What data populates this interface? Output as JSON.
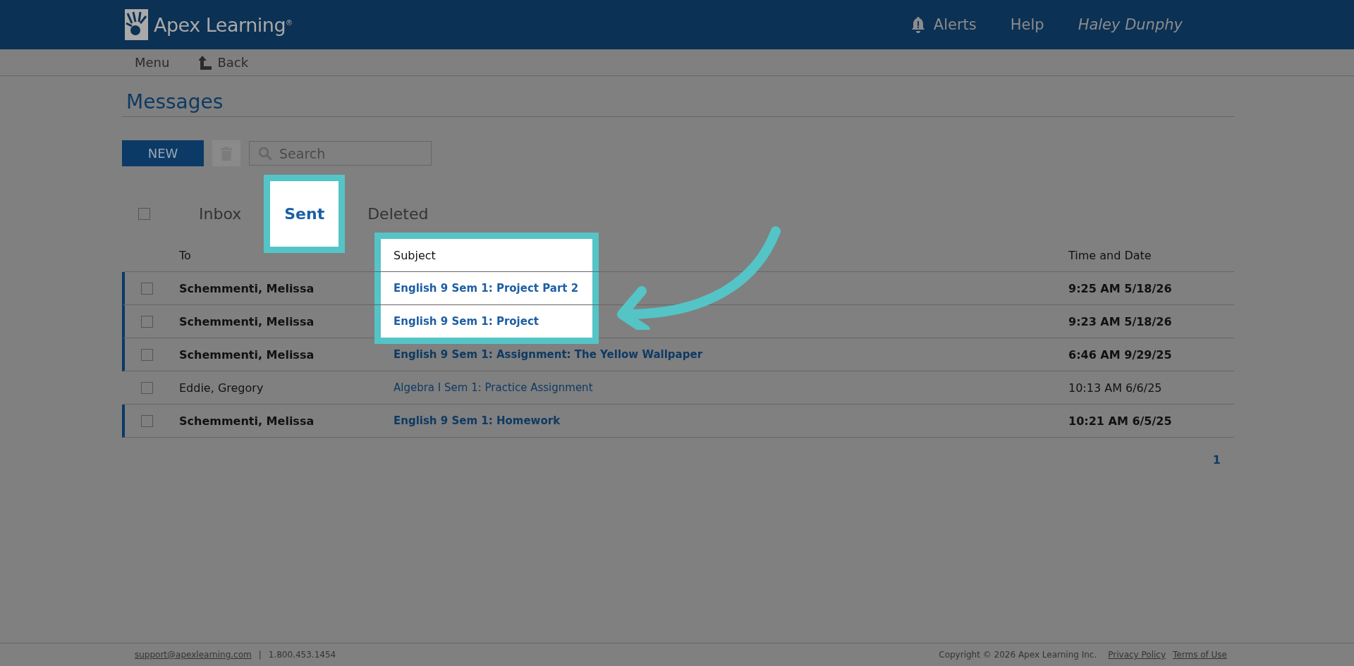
{
  "header": {
    "logo": "Apex Learning",
    "logo_mark": "®",
    "nav": [
      "Alerts",
      "Help"
    ],
    "user": "Haley Dunphy"
  },
  "subnav": {
    "menu": "Menu",
    "back": "Back"
  },
  "page_title": "Messages",
  "toolbar": {
    "new_button": "NEW",
    "search": {
      "placeholder": "Search"
    }
  },
  "select_all": {
    "checked": false
  },
  "tabs": [
    {
      "label": "Inbox",
      "selected": false,
      "highlighted": false
    },
    {
      "label": "Sent",
      "selected": true,
      "highlighted": true
    },
    {
      "label": "Deleted",
      "selected": false,
      "highlighted": false
    }
  ],
  "table": {
    "columns": [
      "To",
      "Subject",
      "Time and Date"
    ],
    "subject_highlighted": true,
    "rows": [
      {
        "to": "Schemmenti, Melissa",
        "subject": "English 9 Sem 1: Project Part 2",
        "time": "9:25 AM 5/18/26",
        "unread": true,
        "checked": false,
        "highlighted": true
      },
      {
        "to": "Schemmenti, Melissa",
        "subject": "English 9 Sem 1: Project",
        "time": "9:23 AM 5/18/26",
        "unread": true,
        "checked": false,
        "highlighted": true
      },
      {
        "to": "Schemmenti, Melissa",
        "subject": "English 9 Sem 1: Assignment: The Yellow Wallpaper",
        "time": "6:46 AM 9/29/25",
        "unread": true,
        "checked": false,
        "highlighted": false
      },
      {
        "to": "Eddie, Gregory",
        "subject": "Algebra I Sem 1: Practice Assignment",
        "time": "10:13 AM 6/6/25",
        "unread": false,
        "checked": false,
        "highlighted": false
      },
      {
        "to": "Schemmenti, Melissa",
        "subject": "English 9 Sem 1: Homework",
        "time": "10:21 AM 6/5/25",
        "unread": true,
        "checked": false,
        "highlighted": false
      }
    ]
  },
  "pagination": [
    {
      "label": "1",
      "selected": true
    }
  ],
  "footer": {
    "email": "support@apexlearning.com",
    "separator": "|",
    "phone": "1.800.453.1454",
    "copyright": "Copyright © 2026 Apex Learning Inc.",
    "links": [
      "Privacy Policy",
      "Terms of Use"
    ]
  }
}
